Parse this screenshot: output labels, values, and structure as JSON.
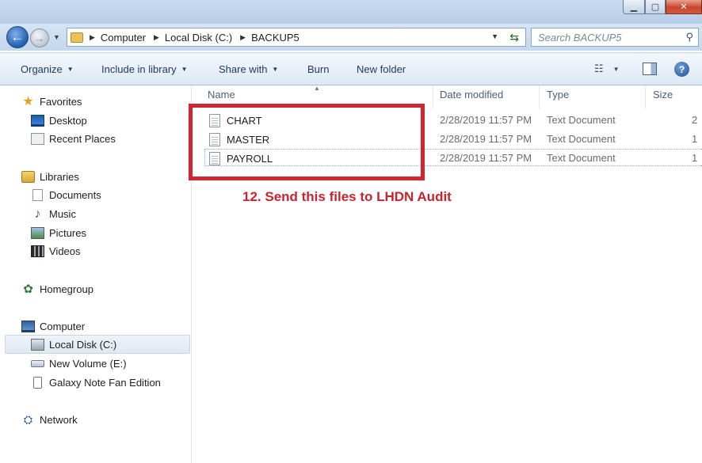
{
  "window": {
    "controls": {
      "minimize": "▁",
      "maximize": "▢",
      "close": "✕"
    }
  },
  "address_bar": {
    "breadcrumbs": [
      "Computer",
      "Local Disk (C:)",
      "BACKUP5"
    ],
    "search_placeholder": "Search BACKUP5"
  },
  "toolbar": {
    "organize": "Organize",
    "include_in_library": "Include in library",
    "share_with": "Share with",
    "burn": "Burn",
    "new_folder": "New folder"
  },
  "nav_pane": {
    "favorites": "Favorites",
    "desktop": "Desktop",
    "recent_places": "Recent Places",
    "libraries": "Libraries",
    "documents": "Documents",
    "music": "Music",
    "pictures": "Pictures",
    "videos": "Videos",
    "homegroup": "Homegroup",
    "computer": "Computer",
    "local_disk": "Local Disk (C:)",
    "new_volume": "New Volume (E:)",
    "galaxy": "Galaxy Note Fan Edition",
    "network": "Network"
  },
  "columns": {
    "name": "Name",
    "date_modified": "Date modified",
    "type": "Type",
    "size": "Size"
  },
  "files": [
    {
      "name": "CHART",
      "date": "2/28/2019 11:57 PM",
      "type": "Text Document",
      "size": "2"
    },
    {
      "name": "MASTER",
      "date": "2/28/2019 11:57 PM",
      "type": "Text Document",
      "size": "1"
    },
    {
      "name": "PAYROLL",
      "date": "2/28/2019 11:57 PM",
      "type": "Text Document",
      "size": "1"
    }
  ],
  "annotation": "12. Send this files to LHDN Audit",
  "colors": {
    "annotation_red": "#c7252e",
    "box_red": "#d02632"
  }
}
